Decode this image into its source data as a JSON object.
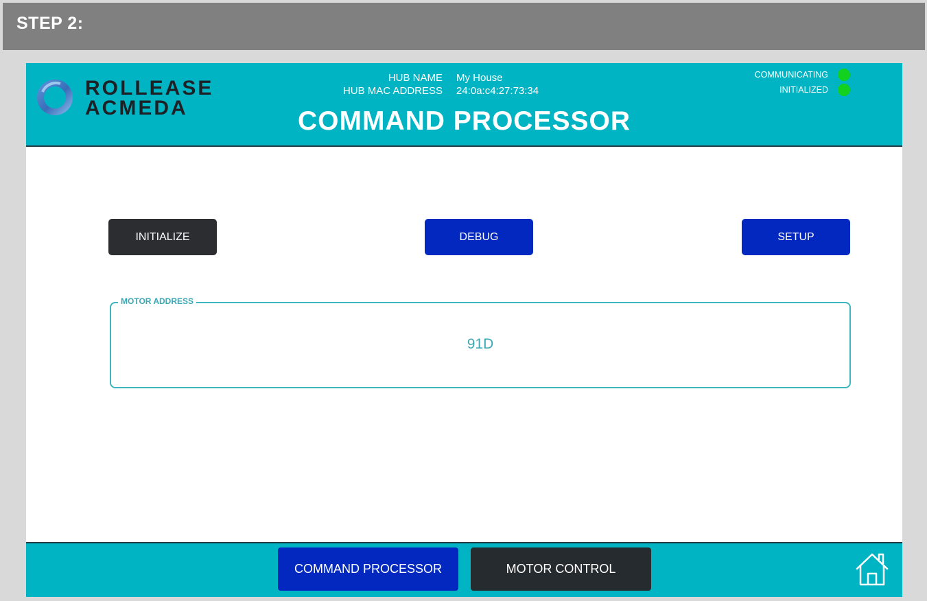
{
  "step": {
    "label": "STEP 2:"
  },
  "header": {
    "logo_line1": "ROLLEASE",
    "logo_line2": "ACMEDA",
    "hub_name_label": "HUB NAME",
    "hub_name": "My House",
    "hub_mac_label": "HUB MAC ADDRESS",
    "hub_mac": "24:0a:c4:27:73:34",
    "title": "COMMAND PROCESSOR",
    "status": [
      {
        "label": "COMMUNICATING",
        "color": "#12d11f"
      },
      {
        "label": "INITIALIZED",
        "color": "#12d11f"
      }
    ]
  },
  "actions": {
    "initialize": "INITIALIZE",
    "debug": "DEBUG",
    "setup": "SETUP"
  },
  "motor": {
    "legend": "MOTOR ADDRESS",
    "value": "91D"
  },
  "footer": {
    "tab_command": "COMMAND PROCESSOR",
    "tab_motor": "MOTOR CONTROL",
    "home_icon": "home-icon"
  },
  "colors": {
    "accent": "#00b4c4",
    "primary_button": "#0328bf",
    "dark_button": "#2b2d30",
    "status_ok": "#12d11f"
  }
}
